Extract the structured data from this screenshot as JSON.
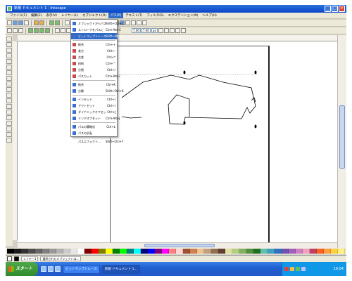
{
  "window": {
    "title": "新規 ドキュメント 1 - Inkscape"
  },
  "menubar": [
    "ファイル(F)",
    "編集(E)",
    "表示(V)",
    "レイヤー(L)",
    "オブジェクト(O)",
    "パス(P)",
    "テキスト(T)",
    "フィルタ(S)",
    "エクステンション(N)",
    "ヘルプ(H)"
  ],
  "menubar_active_index": 4,
  "toolbar2": {
    "x_value": "7.00",
    "y_value": "7.00",
    "unit": "px"
  },
  "dropdown": {
    "items": [
      {
        "label": "オブジェクトからパスへ",
        "shortcut": "Shift+Ctrl+C",
        "icon": "path-icon",
        "color": "#3a6fd0"
      },
      {
        "label": "ストロークをパスに",
        "shortcut": "Ctrl+Alt+C",
        "icon": "stroke-icon",
        "color": "#3a6fd0"
      },
      {
        "label": "ビットマップトレース...",
        "shortcut": "Shift+Alt+B",
        "icon": "trace-icon",
        "color": "#3a6fd0",
        "highlighted": true
      },
      {
        "separator": true
      },
      {
        "label": "統合",
        "shortcut": "Ctrl++",
        "icon": "union-icon",
        "color": "#c84a4a"
      },
      {
        "label": "差分",
        "shortcut": "Ctrl+-",
        "icon": "difference-icon",
        "color": "#c84a4a"
      },
      {
        "label": "交差",
        "shortcut": "Ctrl+*",
        "icon": "intersection-icon",
        "color": "#c84a4a"
      },
      {
        "label": "排他",
        "shortcut": "Ctrl+^",
        "icon": "exclusion-icon",
        "color": "#c84a4a"
      },
      {
        "label": "分割",
        "shortcut": "Ctrl+/",
        "icon": "division-icon",
        "color": "#c84a4a"
      },
      {
        "label": "パスカット",
        "shortcut": "Ctrl+Alt+/",
        "icon": "cut-path-icon",
        "color": "#c84a4a"
      },
      {
        "separator": true
      },
      {
        "label": "結合",
        "shortcut": "Ctrl+K",
        "icon": "combine-icon",
        "color": "#3a6fd0"
      },
      {
        "label": "分解",
        "shortcut": "Shift+Ctrl+K",
        "icon": "break-apart-icon",
        "color": "#3a6fd0"
      },
      {
        "separator": true
      },
      {
        "label": "インセット",
        "shortcut": "Ctrl+(",
        "icon": "inset-icon",
        "color": "#3a6fd0"
      },
      {
        "label": "アウトセット",
        "shortcut": "Ctrl+)",
        "icon": "outset-icon",
        "color": "#3a6fd0"
      },
      {
        "label": "ダイナミックオフセット",
        "shortcut": "Ctrl+J",
        "icon": "dynamic-offset-icon",
        "color": "#3a6fd0"
      },
      {
        "label": "リンクオフセット",
        "shortcut": "Ctrl+Alt+J",
        "icon": "linked-offset-icon",
        "color": "#3a6fd0"
      },
      {
        "separator": true
      },
      {
        "label": "パスの簡略化",
        "shortcut": "Ctrl+L",
        "icon": "simplify-icon",
        "color": "#3a6fd0"
      },
      {
        "label": "パスの反転",
        "shortcut": "",
        "icon": "reverse-icon",
        "color": "#3a6fd0"
      },
      {
        "separator": true
      },
      {
        "label": "パスエフェクト...",
        "shortcut": "Shift+Ctrl+7",
        "icon": "",
        "color": ""
      }
    ]
  },
  "statusbar": {
    "layer": "レイヤー1",
    "message": "選択されたオブジェクトは..."
  },
  "taskbar": {
    "start_label": "スタート",
    "tasks": [
      {
        "label": "ビットマップトレース",
        "active": false
      },
      {
        "label": "新規 ドキュメント 1...",
        "active": true
      }
    ],
    "clock": "19:04"
  },
  "palette_colors": [
    "#000000",
    "#1a1a1a",
    "#333333",
    "#4d4d4d",
    "#666666",
    "#808080",
    "#999999",
    "#b3b3b3",
    "#cccccc",
    "#e6e6e6",
    "#ffffff",
    "#800000",
    "#ff0000",
    "#808000",
    "#ffff00",
    "#008000",
    "#00ff00",
    "#008080",
    "#00ffff",
    "#000080",
    "#0000ff",
    "#800080",
    "#ff00ff",
    "#ff8080",
    "#ffd5d5",
    "#a05030",
    "#d08050",
    "#f0c090",
    "#c0a080",
    "#907050",
    "#604030",
    "#e0e0a0",
    "#b0d080",
    "#80b060",
    "#509040",
    "#207020",
    "#60c0b0",
    "#40a0c0",
    "#3070c0",
    "#7050b0",
    "#a060c0",
    "#d080c0",
    "#f0a0c0",
    "#c04060",
    "#ff6020",
    "#ffa040",
    "#ffd040",
    "#fff080"
  ]
}
